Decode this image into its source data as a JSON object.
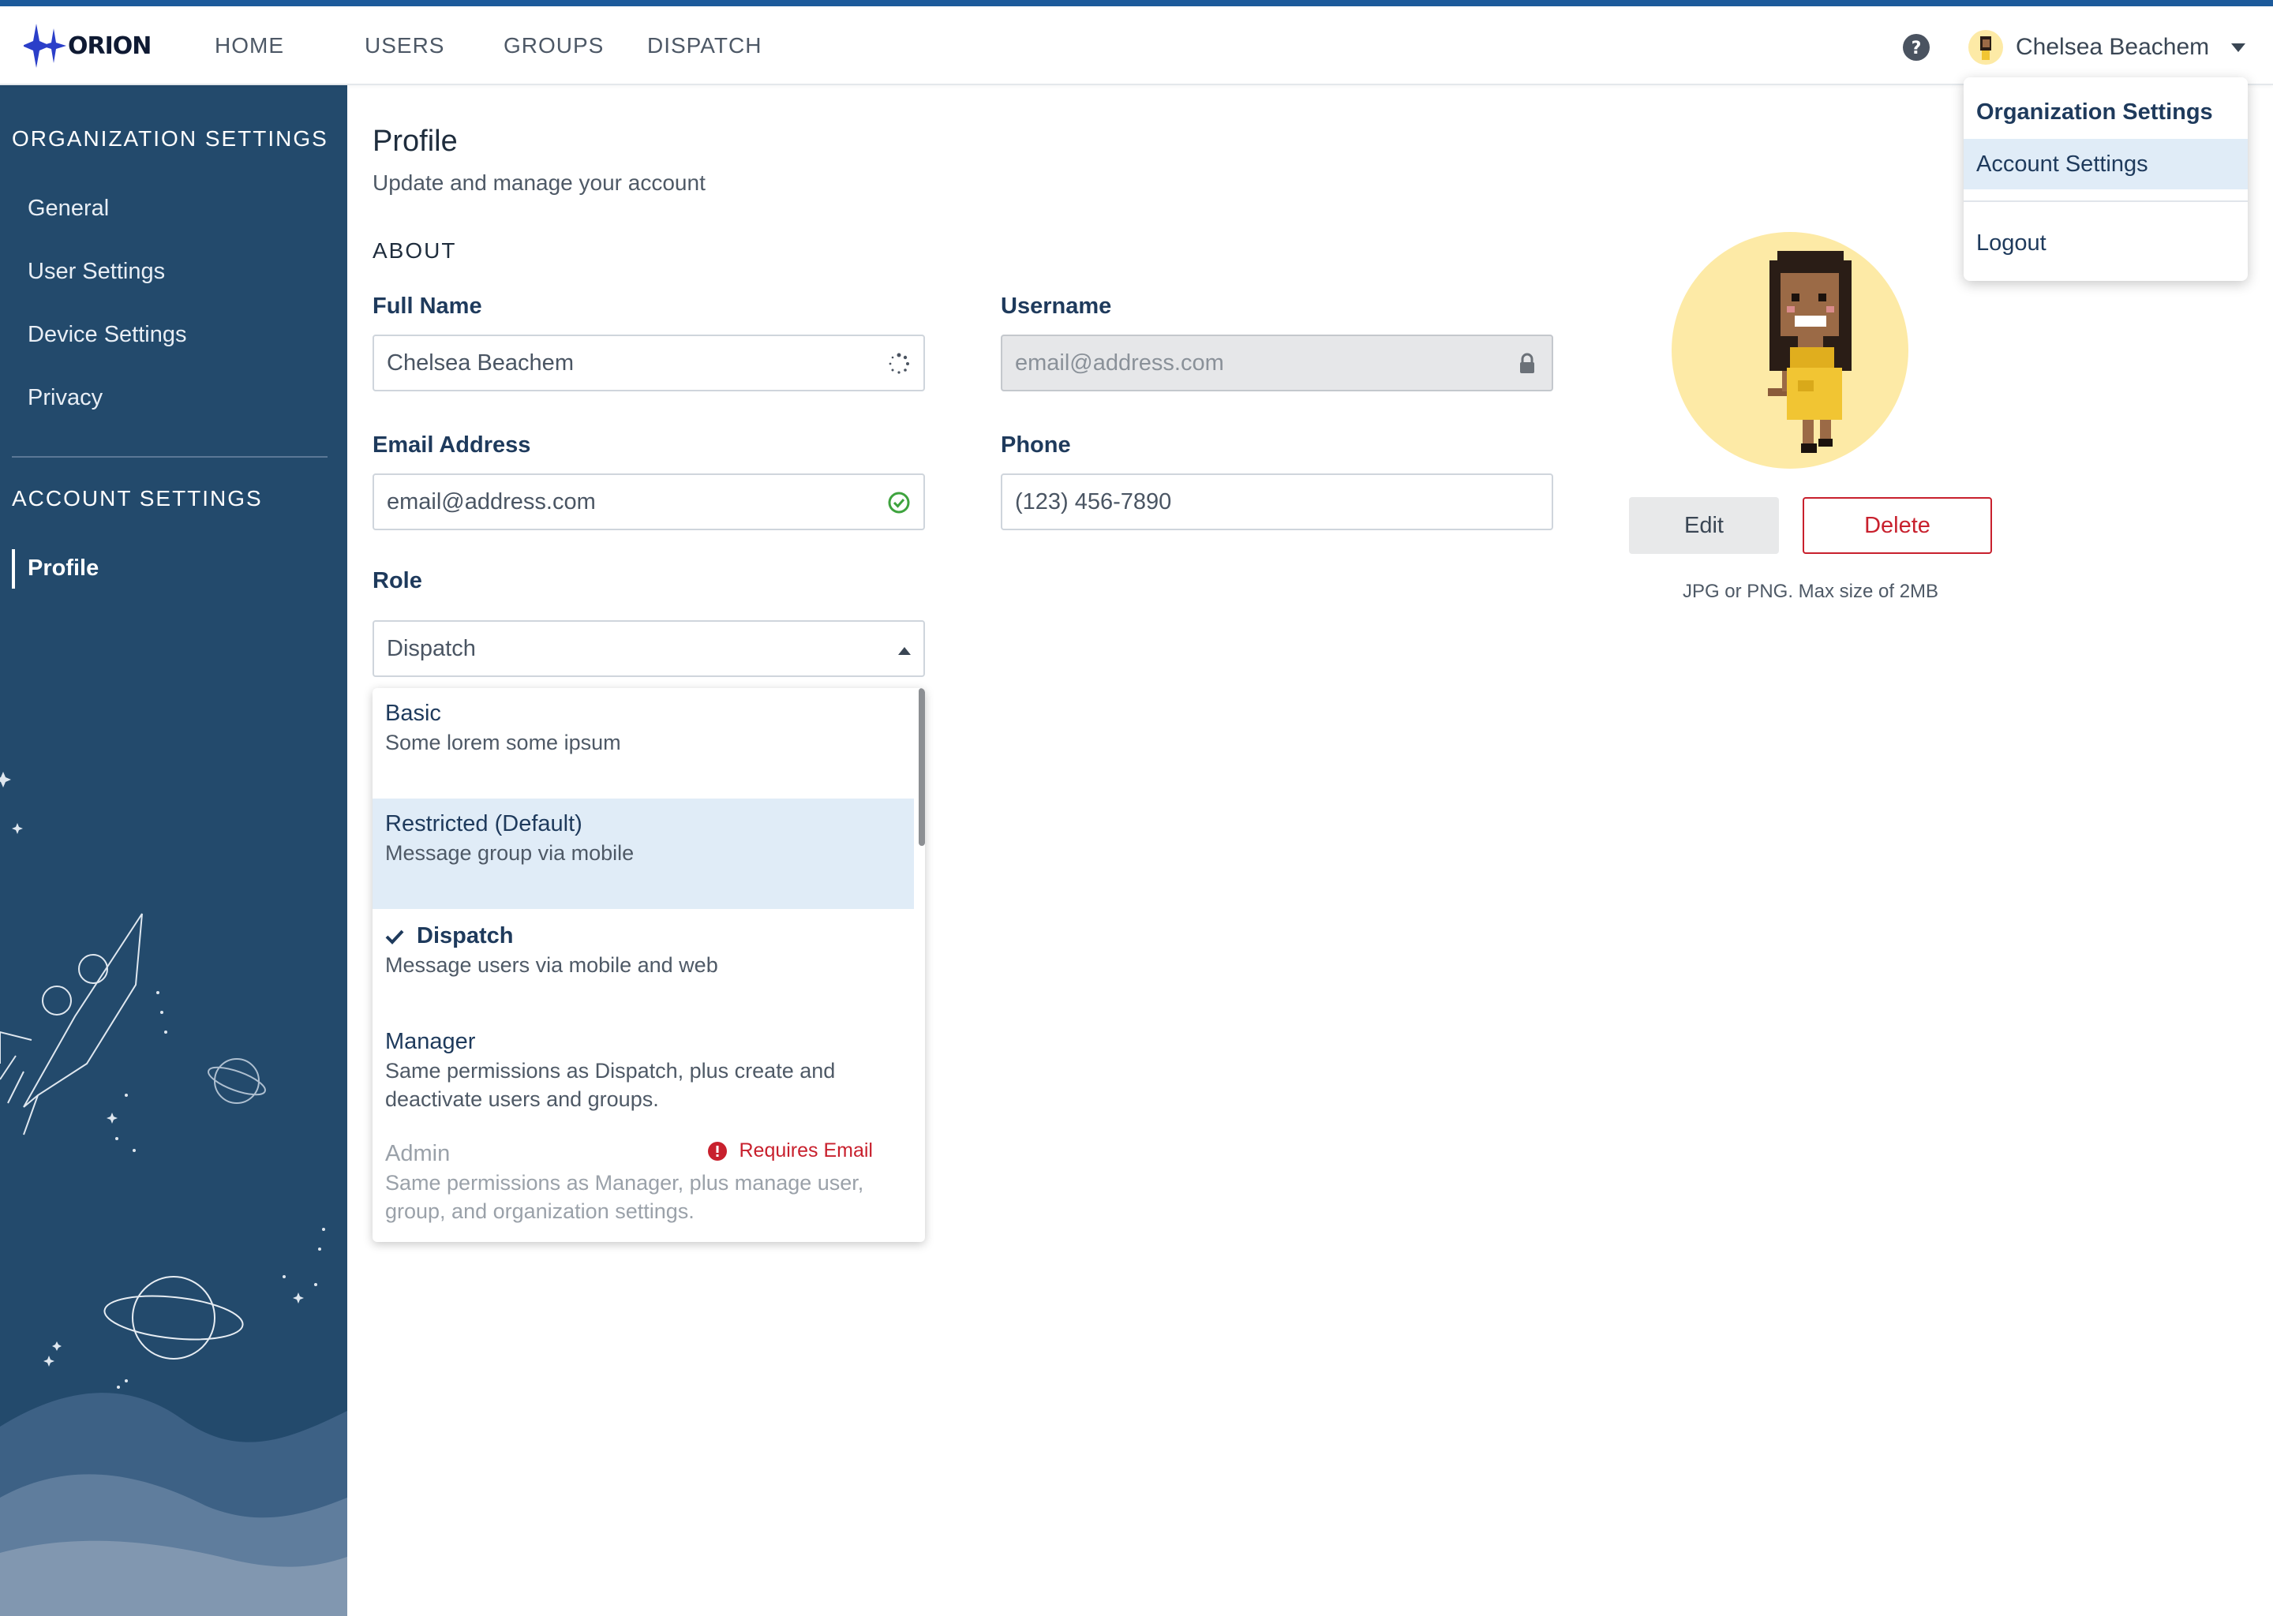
{
  "app": {
    "logo_text": "ORION",
    "nav": [
      "HOME",
      "USERS",
      "GROUPS",
      "DISPATCH"
    ],
    "user_name": "Chelsea Beachem",
    "accent_color": "#1c5a9b",
    "sidebar_color": "#234a6c"
  },
  "account_menu": {
    "items": [
      "Organization Settings",
      "Account Settings",
      "Logout"
    ],
    "highlighted": "Account Settings"
  },
  "sidebar": {
    "org_heading": "ORGANIZATION SETTINGS",
    "org_items": [
      "General",
      "User Settings",
      "Device Settings",
      "Privacy"
    ],
    "account_heading": "ACCOUNT SETTINGS",
    "account_items": [
      "Profile"
    ],
    "active_item": "Profile"
  },
  "profile": {
    "title": "Profile",
    "subtitle": "Update and manage your account",
    "section": "ABOUT",
    "full_name": {
      "label": "Full Name",
      "value": "Chelsea Beachem",
      "status_icon": "loading-spinner-icon"
    },
    "username": {
      "label": "Username",
      "placeholder": "email@address.com",
      "disabled": true,
      "icon": "lock-icon"
    },
    "email": {
      "label": "Email Address",
      "placeholder": "email@address.com",
      "status_icon": "check-circle-icon"
    },
    "phone": {
      "label": "Phone",
      "placeholder": "(123) 456-7890"
    },
    "role": {
      "label": "Role",
      "value": "Dispatch",
      "options": [
        {
          "title": "Basic",
          "desc": "Some lorem some ipsum"
        },
        {
          "title": "Restricted (Default)",
          "desc": "Message group via mobile"
        },
        {
          "title": "Dispatch",
          "desc": "Message users via mobile and web"
        },
        {
          "title": "Manager",
          "desc": "Same permissions as Dispatch, plus create and deactivate users and groups."
        },
        {
          "title": "Admin",
          "desc": "Same permissions as Manager, plus manage user, group, and organization settings.",
          "warning": "Requires Email"
        }
      ],
      "selected_index": 2,
      "highlighted_index": 1,
      "disabled_index": 4
    },
    "avatar": {
      "edit_label": "Edit",
      "delete_label": "Delete",
      "hint": "JPG or PNG. Max size of 2MB"
    }
  }
}
